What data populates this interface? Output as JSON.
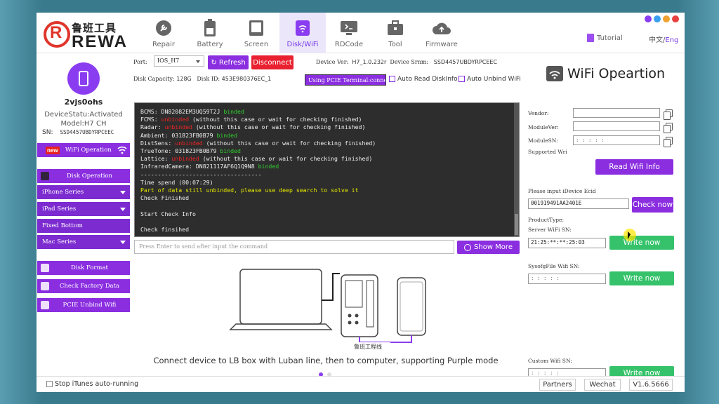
{
  "logo": {
    "cn": "鲁班工具",
    "en": "REWA"
  },
  "nav": [
    {
      "label": "Repair",
      "icon": "wrench-icon"
    },
    {
      "label": "Battery",
      "icon": "battery-icon"
    },
    {
      "label": "Screen",
      "icon": "screen-icon"
    },
    {
      "label": "Disk/WiFi",
      "icon": "disk-wifi-icon"
    },
    {
      "label": "RDCode",
      "icon": "rdcode-icon"
    },
    {
      "label": "Tool",
      "icon": "toolbox-icon"
    },
    {
      "label": "Firmware",
      "icon": "cloud-upload-icon"
    }
  ],
  "header": {
    "tutorial": "Tutorial",
    "lang_cn": "中文/",
    "lang_en": "Eng"
  },
  "device": {
    "name": "2vjs0ohs",
    "status": "DeviceStatu:Activated",
    "model": "Model:H7 CH",
    "sn_label": "SN:",
    "sn": "SSD4457UBDYRPCEEC"
  },
  "menu": {
    "wifi": "WiFi Operation",
    "new_badge": "new",
    "disk": "Disk Operation",
    "iphone": "iPhone Series",
    "ipad": "iPad Series",
    "fixed": "Fixed Bottom",
    "mac": "Mac Series",
    "format": "Disk Format",
    "factory": "Check Factory Data",
    "unbind": "PCIE Unbind Wifi"
  },
  "toolbar": {
    "port_label": "Port:",
    "port_value": "IOS_H7",
    "refresh": "Refresh",
    "disconnect": "Disconnect",
    "device_ver_label": "Device Ver:",
    "device_ver": "H7_1.0.232r",
    "device_srnm_label": "Device Srnm:",
    "device_srnm": "SSD4457UBDYRPCEEC",
    "disk_cap_label": "Disk Capacity:",
    "disk_cap": "128G",
    "disk_id_label": "Disk ID:",
    "disk_id": "453E980376EC_1",
    "pcie": "Using PCIE Terminal:conne",
    "auto_read": "Auto Read DiskInfo",
    "auto_unbind": "Auto Unbind WiFi"
  },
  "terminal": {
    "l1a": "BCMS: DN82082EM3UQ59T2J ",
    "l1b": "binded",
    "l2a": "FCMS: ",
    "l2b": "unbinded",
    "l2c": " (without this case or wait for checking finished)",
    "l3a": "Radar: ",
    "l3b": "unbinded",
    "l3c": " (without this case or wait for checking finished)",
    "l4a": "Ambient: 031823FB0B79 ",
    "l4b": "binded",
    "l5a": "DistSens: ",
    "l5b": "unbinded",
    "l5c": " (without this case or wait for checking finished)",
    "l6a": "TrueTone: 031823FB0B79 ",
    "l6b": "binded",
    "l7a": "Lattice: ",
    "l7b": "unbinded",
    "l7c": " (without this case or wait for checking finished)",
    "l8a": "InfraredCamera: DN821117AF6Q1Q9N8 ",
    "l8b": "binded",
    "l9": "-----------------------------------",
    "l10": "Time spend (00:07:29)",
    "l11": "Part of data still unbinded, please use deep search to solve it",
    "l12": "Check Finished",
    "l13": "Start Check Info",
    "l14": "Check finsihed"
  },
  "command": {
    "placeholder": "Press Enter to send after input the command",
    "show_more": "Show More"
  },
  "illustration": {
    "cable_label": "鲁班工程线",
    "caption": "Connect device to LB box with Luban line, then to computer, supporting Purple mode"
  },
  "wifi": {
    "title": "WiFi Opeartion",
    "vendor_label": "Vendor:",
    "modulever_label": "ModuleVer:",
    "modulesn_label": "ModuleSN:",
    "modulesn_value": ": : : : :",
    "supported_label": "Supported Wri",
    "read_btn": "Read Wifi Info",
    "ecid_label": "Please input iDevice Ecid",
    "ecid_value": "001919491AA2401E",
    "check_btn": "Check now",
    "product_label": "ProductType:",
    "server_label": "Server WiFi SN:",
    "server_value": "21:25:**:**:25:03",
    "write1": "Write now",
    "sysconfig_label": "SysofgFile Wifi SN:",
    "sysconfig_value": ": : : : :",
    "write2": "Write now",
    "custom_label": "Custom Wifi SN:",
    "custom_value": ": : : : :",
    "write3": "Write now"
  },
  "footer": {
    "stop_itunes": "Stop iTunes auto-running",
    "partners": "Partners",
    "wechat": "Wechat",
    "version": "V1.6.5666"
  }
}
